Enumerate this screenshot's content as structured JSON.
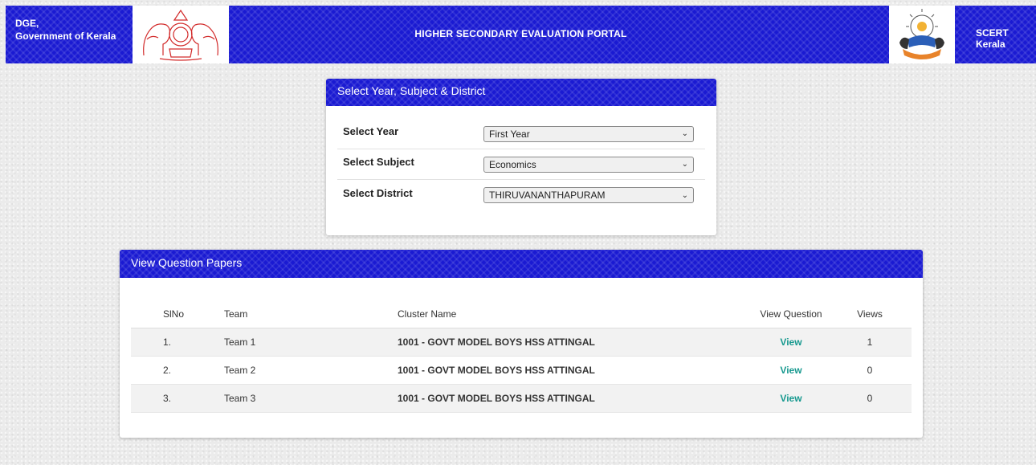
{
  "header": {
    "org_line1": "DGE,",
    "org_line2": "Government of Kerala",
    "title": "HIGHER SECONDARY EVALUATION PORTAL",
    "right_org": "SCERT Kerala",
    "left_emblem_icon": "kerala-state-emblem-icon",
    "right_emblem_icon": "scert-kerala-logo-icon"
  },
  "selection": {
    "title": "Select Year, Subject & District",
    "fields": [
      {
        "label": "Select Year",
        "value": "First Year"
      },
      {
        "label": "Select Subject",
        "value": "Economics"
      },
      {
        "label": "Select District",
        "value": "THIRUVANANTHAPURAM"
      }
    ]
  },
  "papers": {
    "title": "View Question Papers",
    "columns": [
      "SlNo",
      "Team",
      "Cluster Name",
      "View Question",
      "Views"
    ],
    "rows": [
      {
        "sl": "1.",
        "team": "Team 1",
        "cluster": "1001 - GOVT MODEL BOYS HSS ATTINGAL",
        "action": "View",
        "views": "1"
      },
      {
        "sl": "2.",
        "team": "Team 2",
        "cluster": "1001 - GOVT MODEL BOYS HSS ATTINGAL",
        "action": "View",
        "views": "0"
      },
      {
        "sl": "3.",
        "team": "Team 3",
        "cluster": "1001 - GOVT MODEL BOYS HSS ATTINGAL",
        "action": "View",
        "views": "0"
      }
    ]
  },
  "colors": {
    "header_blue": "#1a1ad2",
    "link_teal": "#17998f",
    "emblem_red": "#d22a2a"
  }
}
